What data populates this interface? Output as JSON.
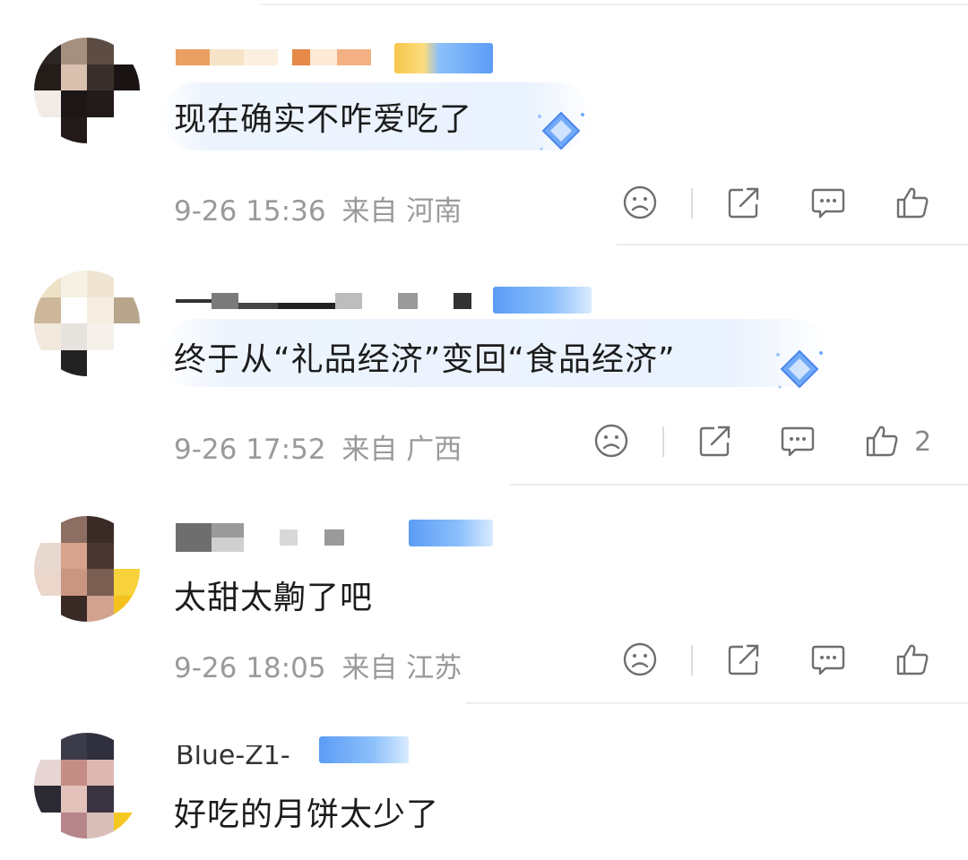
{
  "comments": [
    {
      "text": "现在确实不咋爱吃了",
      "time": "9-26 15:36",
      "location": "来自 河南",
      "likes": ""
    },
    {
      "text": "终于从“礼品经济”变回“食品经济”",
      "time": "9-26 17:52",
      "location": "来自 广西",
      "likes": "2"
    },
    {
      "text": "太甜太齁了吧",
      "time": "9-26 18:05",
      "location": "来自 江苏",
      "likes": ""
    },
    {
      "username": "Blue-Z1-",
      "text": "好吃的月饼太少了"
    }
  ],
  "icons": {
    "dislike": "sad-face-icon",
    "share": "share-icon",
    "reply": "comment-icon",
    "like": "thumbs-up-icon"
  },
  "colors": {
    "text": "#1c1c1c",
    "meta": "#9a9a9a",
    "bubble": "#eaf2fe",
    "icon": "#6f6f6f",
    "badge": "#5b9cf6"
  }
}
